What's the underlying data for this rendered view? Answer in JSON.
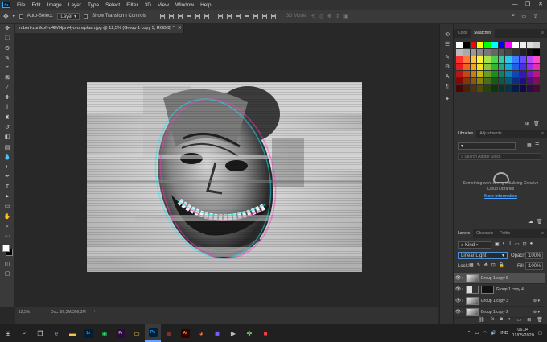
{
  "menu": [
    "File",
    "Edit",
    "Image",
    "Layer",
    "Type",
    "Select",
    "Filter",
    "3D",
    "View",
    "Window",
    "Help"
  ],
  "options_bar": {
    "auto_select_label": "Auto-Select:",
    "auto_select_value": "Layer",
    "transform_label": "Show Transform Controls",
    "mode_3d": "3D Mode:"
  },
  "document_tab": "robert-zunikoff-o4llVHjsnHyo-unsplash.jpg @ 12,5% (Group 1 copy 5, RGB/8) *",
  "status": {
    "zoom": "12,5%",
    "doc": "Doc: 86,3M/306,3M"
  },
  "swatches_panel": {
    "tabs": [
      "Color",
      "Swatches"
    ],
    "active_tab": "Swatches",
    "rows": [
      [
        "#ffffff",
        "#000000",
        "#ff0000",
        "#ffff00",
        "#00ff00",
        "#00ffff",
        "#0000ff",
        "#ff00ff",
        "#ffffff",
        "#eeeeee",
        "#dddddd",
        "#cccccc"
      ],
      [
        "#bbbbbb",
        "#aaaaaa",
        "#999999",
        "#888888",
        "#777777",
        "#666666",
        "#555555",
        "#444444",
        "#333333",
        "#222222",
        "#111111",
        "#000000"
      ],
      [
        "#ff3030",
        "#ff7a3a",
        "#ffc13a",
        "#fff23a",
        "#a9e34b",
        "#4bd34b",
        "#38c9a0",
        "#2fc8e8",
        "#3a7dff",
        "#6a4bff",
        "#b14bff",
        "#ff4bc8"
      ],
      [
        "#e81c1c",
        "#f0641e",
        "#f5a418",
        "#f5e218",
        "#8cc63f",
        "#2eb82e",
        "#1ea886",
        "#12a8d8",
        "#1e5ee8",
        "#4a2ee8",
        "#9a2ee8",
        "#e82ea8"
      ],
      [
        "#b81414",
        "#c04a12",
        "#c88010",
        "#c8b810",
        "#6a9c28",
        "#1e8c1e",
        "#128068",
        "#0a82ac",
        "#1244b8",
        "#3418b8",
        "#7618b8",
        "#b8187e"
      ],
      [
        "#800a0a",
        "#883408",
        "#8e5a08",
        "#8e8208",
        "#4a6e1a",
        "#125e12",
        "#0a5a48",
        "#065a78",
        "#0a2e80",
        "#220e80",
        "#520e80",
        "#800e58"
      ],
      [
        "#4a0505",
        "#502004",
        "#543404",
        "#544c04",
        "#2c420e",
        "#0a380a",
        "#06362a",
        "#043648",
        "#061a4c",
        "#14084c",
        "#30084c",
        "#4c0834"
      ]
    ]
  },
  "libraries_panel": {
    "tabs": [
      "Libraries",
      "Adjustments"
    ],
    "active_tab": "Libraries",
    "search_placeholder": "Search Adobe Stock",
    "message": "Something went wrong initializing Creative Cloud Libraries",
    "link": "More information"
  },
  "layers_panel": {
    "tabs": [
      "Layers",
      "Channels",
      "Paths"
    ],
    "active_tab": "Layers",
    "filter_label": "Kind",
    "blend_mode": "Linear Light",
    "opacity_label": "Opacity:",
    "opacity_value": "100%",
    "lock_label": "Lock:",
    "fill_label": "Fill:",
    "fill_value": "100%",
    "layers": [
      {
        "name": "Group 1 copy 5",
        "active": true
      },
      {
        "name": "Group 1 copy 4",
        "active": false
      },
      {
        "name": "Group 1 copy 3",
        "active": false
      },
      {
        "name": "Group 1 copy 2",
        "active": false
      }
    ]
  },
  "taskbar": {
    "apps": [
      {
        "label": "Lr",
        "bg": "#001e36",
        "fg": "#31a8ff"
      },
      {
        "label": "Pr",
        "bg": "#2a0c3a",
        "fg": "#e87dff"
      },
      {
        "label": "Ps",
        "bg": "#001e36",
        "fg": "#31a8ff"
      },
      {
        "label": "Ai",
        "bg": "#330000",
        "fg": "#ff9a00"
      }
    ],
    "language": "IND",
    "time": "06.04",
    "date": "11/05/2020"
  }
}
